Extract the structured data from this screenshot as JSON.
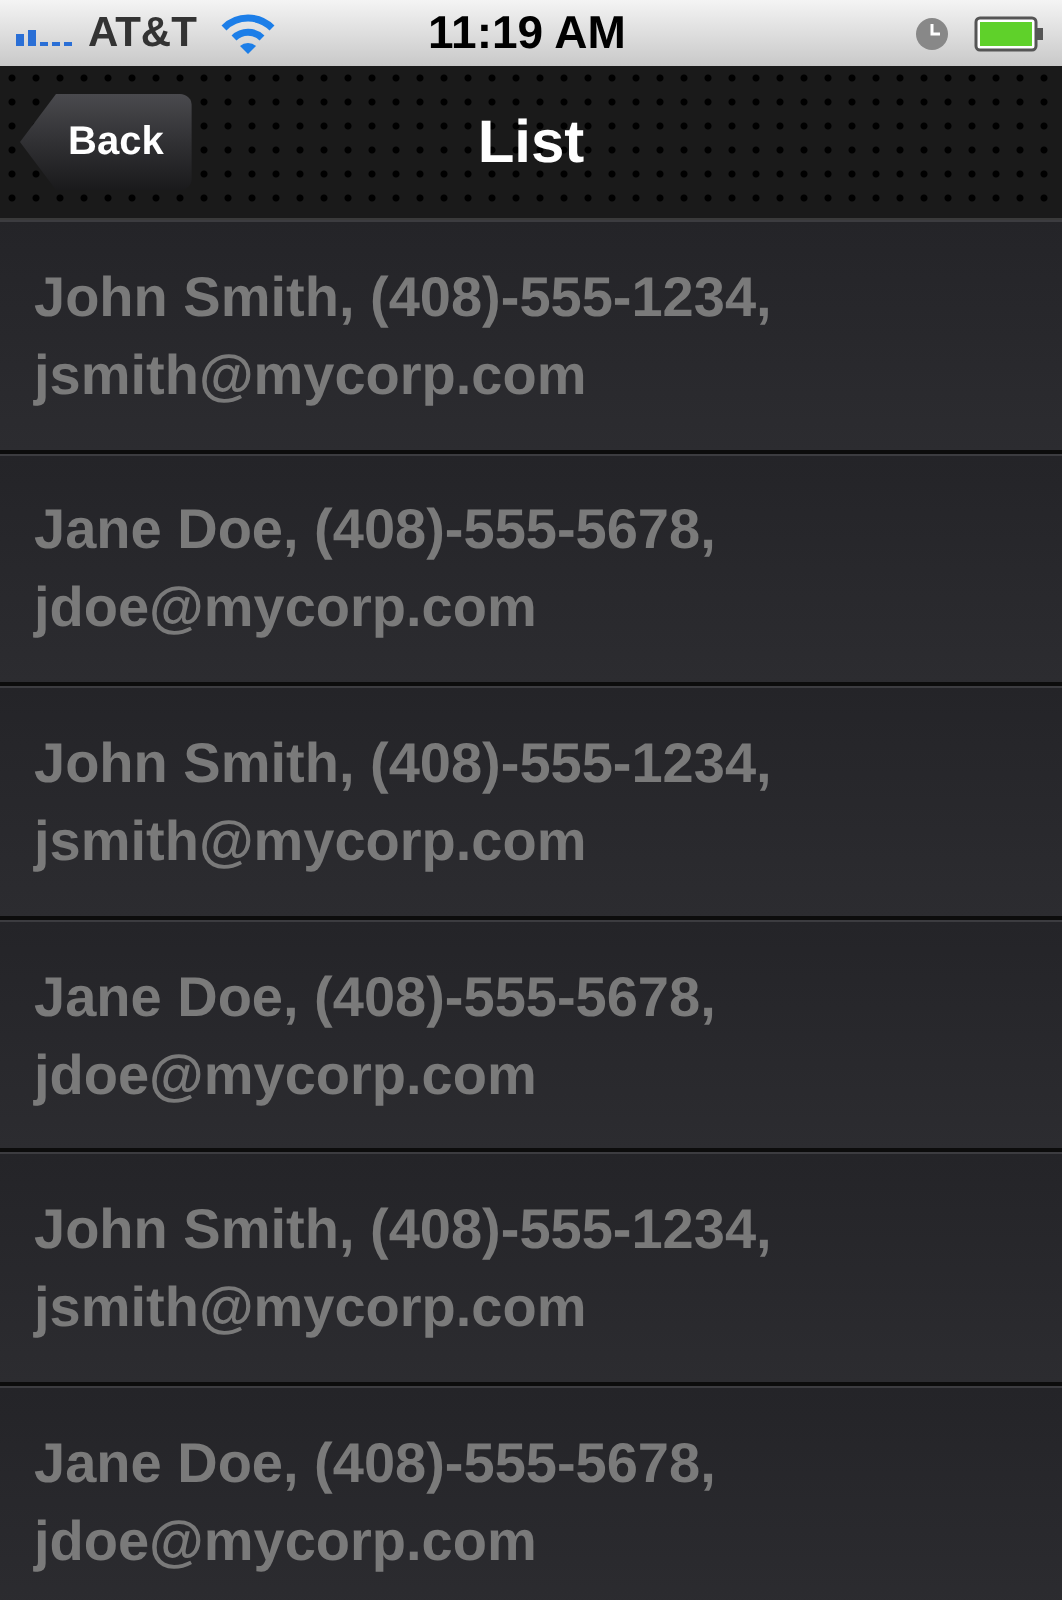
{
  "status_bar": {
    "carrier": "AT&T",
    "time": "11:19 AM"
  },
  "nav_bar": {
    "back_button": "Back",
    "title": "List"
  },
  "rows": [
    {
      "text": "John Smith, (408)-555-1234, jsmith@mycorp.com"
    },
    {
      "text": "Jane Doe, (408)-555-5678, jdoe@mycorp.com"
    },
    {
      "text": "John Smith, (408)-555-1234, jsmith@mycorp.com"
    },
    {
      "text": "Jane Doe, (408)-555-5678, jdoe@mycorp.com"
    },
    {
      "text": "John Smith, (408)-555-1234, jsmith@mycorp.com"
    },
    {
      "text": "Jane Doe, (408)-555-5678, jdoe@mycorp.com"
    }
  ]
}
